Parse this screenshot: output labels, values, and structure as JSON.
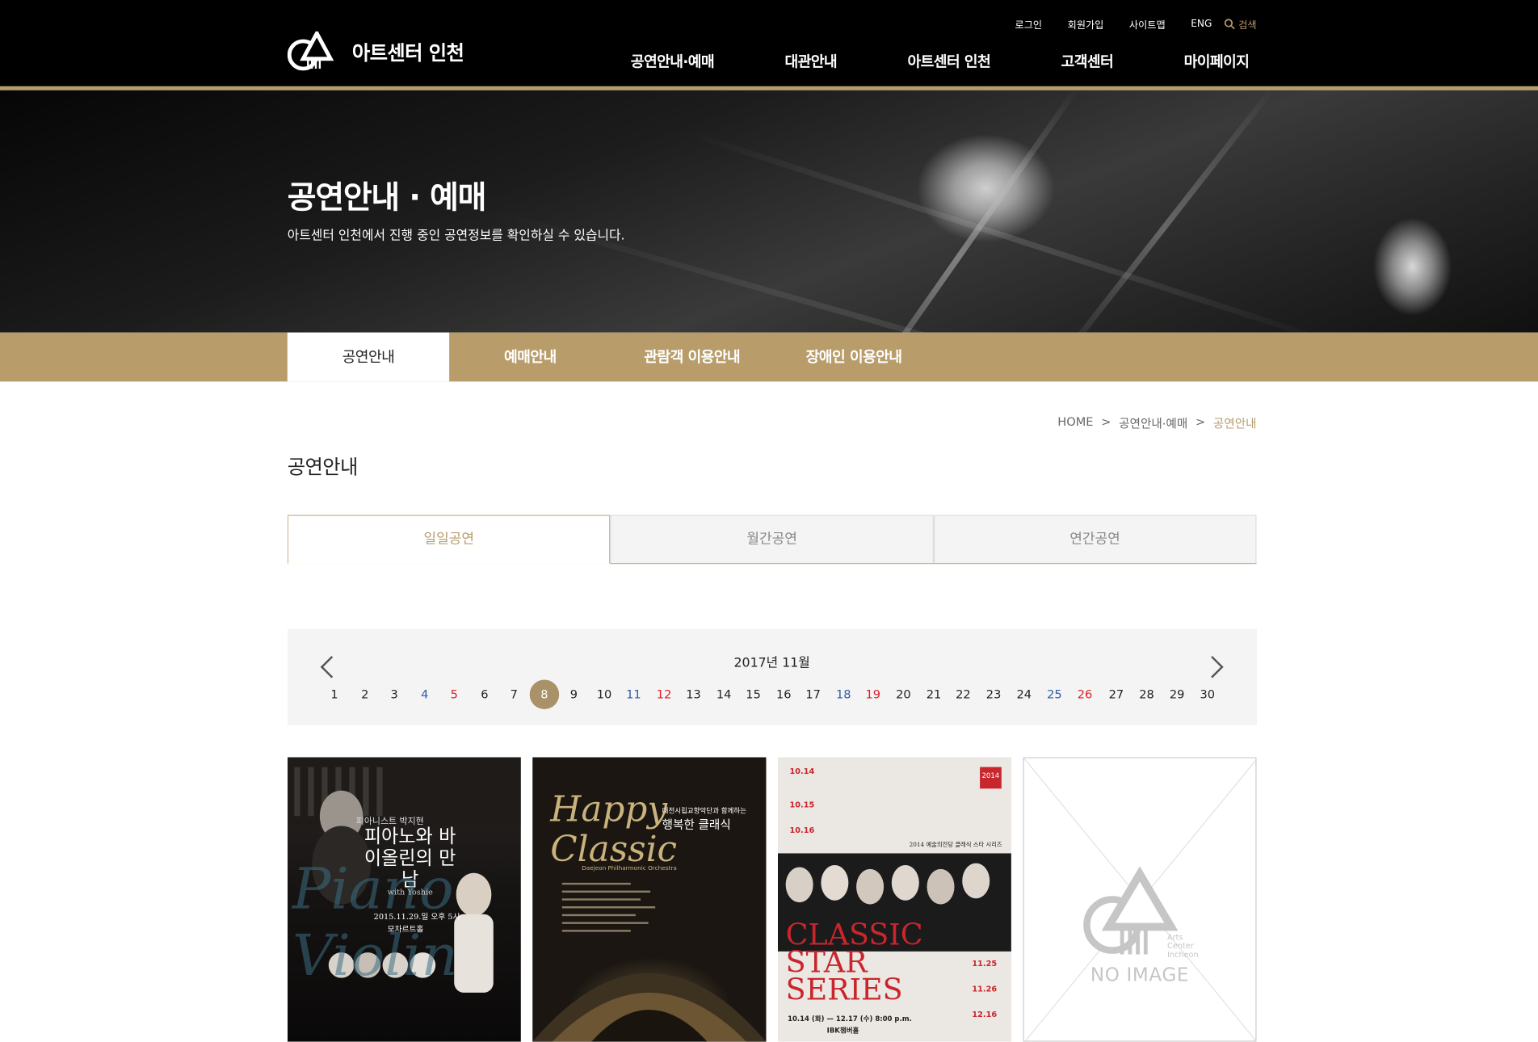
{
  "header": {
    "logo_text": "아트센터 인천",
    "utils": [
      "로그인",
      "회원가입",
      "사이트맵",
      "ENG"
    ],
    "search_label": "검색",
    "gnb": [
      "공연안내·예매",
      "대관안내",
      "아트센터 인천",
      "고객센터",
      "마이페이지"
    ]
  },
  "hero": {
    "title": "공연안내 · 예매",
    "subtitle": "아트센터 인천에서 진행 중인 공연정보를 확인하실 수 있습니다."
  },
  "lnb": [
    "공연안내",
    "예매안내",
    "관람객 이용안내",
    "장애인 이용안내"
  ],
  "breadcrumb": [
    "HOME",
    "공연안내·예매",
    "공연안내"
  ],
  "page_title": "공연안내",
  "tabs": [
    "일일공연",
    "월간공연",
    "연간공연"
  ],
  "calendar": {
    "title": "2017년 11월",
    "days": [
      "1",
      "2",
      "3",
      "4",
      "5",
      "6",
      "7",
      "8",
      "9",
      "10",
      "11",
      "12",
      "13",
      "14",
      "15",
      "16",
      "17",
      "18",
      "19",
      "20",
      "21",
      "22",
      "23",
      "24",
      "25",
      "26",
      "27",
      "28",
      "29",
      "30"
    ],
    "selected": "8"
  },
  "posters": {
    "p1": {
      "title": "피아노와 바이올린의 만남",
      "kicker": "피아니스트 박지현",
      "script": "Piano Violin",
      "with": "with Yoshie",
      "date": "2015.11.29.일 오후 5시",
      "venue": "모차르트홀"
    },
    "p2": {
      "title_en": "Happy Classic",
      "title_ko": "행복한 클래식",
      "kicker": "대전시립교향악단과 함께하는",
      "orchestra": "Daejeon Philharmonic Orchestra"
    },
    "p3": {
      "title": "CLASSIC STAR SERIES",
      "badge": "2014",
      "series": "2014 예술의전당 클래식 스타 시리즈",
      "dates_top": [
        "10.14",
        "10.15",
        "10.16"
      ],
      "dates_right": [
        "11.25",
        "11.26",
        "12.16"
      ],
      "period": "10.14 (화) — 12.17 (수) 8:00 p.m.",
      "sponsor": "IBK챔버홀"
    },
    "p4": {
      "text": "NO IMAGE",
      "logo_small": "Arts Center Incheon"
    }
  }
}
